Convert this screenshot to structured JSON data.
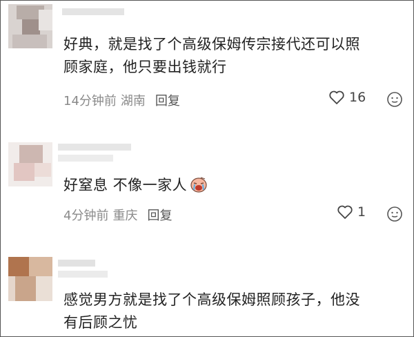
{
  "comments": [
    {
      "text_line1": "好典，就是找了个高级保姆传宗接代还可以照",
      "text_line2": "顾家庭，他只要出钱就行",
      "time": "14分钟前",
      "location": "湖南",
      "reply_label": "回复",
      "likes": "16"
    },
    {
      "text_line1": "好窒息 不像一家人",
      "time": "4分钟前",
      "location": "重庆",
      "reply_label": "回复",
      "likes": "1"
    },
    {
      "text_line1": "感觉男方就是找了个高级保姆照顾孩子，他没",
      "text_line2": "有后顾之忧"
    }
  ],
  "icons": {
    "like": "heart-outline-icon",
    "emoji": "smiley-face-icon",
    "inline_emoji": "crying-face-emoji"
  },
  "colors": {
    "text": "#222222",
    "meta": "#8a8a8a",
    "reply": "#555555"
  }
}
